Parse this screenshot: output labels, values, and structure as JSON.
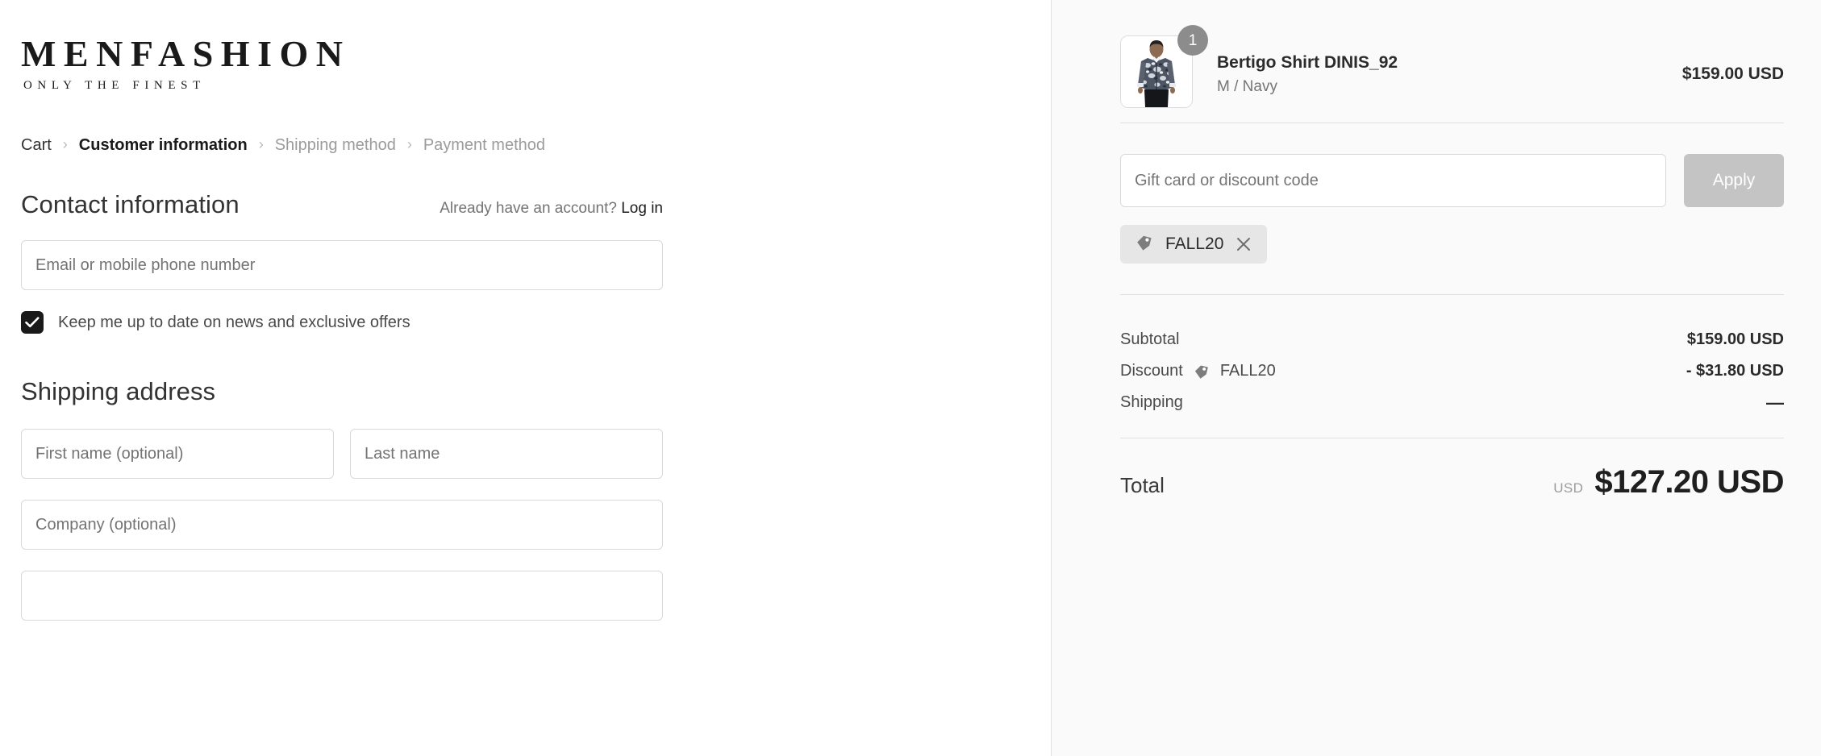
{
  "brand": {
    "name": "MENFASHION",
    "tagline": "ONLY THE FINEST"
  },
  "breadcrumb": {
    "items": [
      {
        "label": "Cart",
        "state": "done"
      },
      {
        "label": "Customer information",
        "state": "active"
      },
      {
        "label": "Shipping method",
        "state": "upcoming"
      },
      {
        "label": "Payment method",
        "state": "upcoming"
      }
    ],
    "separator": "›"
  },
  "contact": {
    "title": "Contact information",
    "account_prompt": "Already have an account?",
    "login_label": "Log in",
    "email_placeholder": "Email or mobile phone number",
    "email_value": "",
    "newsletter_label": "Keep me up to date on news and exclusive offers",
    "newsletter_checked": true
  },
  "shipping_address": {
    "title": "Shipping address",
    "first_name_placeholder": "First name (optional)",
    "first_name_value": "",
    "last_name_placeholder": "Last name",
    "last_name_value": "",
    "company_placeholder": "Company (optional)",
    "company_value": "",
    "address_placeholder": "",
    "address_value": ""
  },
  "order_summary": {
    "line_items": [
      {
        "title": "Bertigo Shirt DINIS_92",
        "variant": "M / Navy",
        "quantity": "1",
        "price": "$159.00 USD"
      }
    ],
    "discount_input_placeholder": "Gift card or discount code",
    "discount_input_value": "",
    "apply_label": "Apply",
    "applied_discounts": [
      {
        "code": "FALL20"
      }
    ],
    "rows": [
      {
        "label": "Subtotal",
        "code": "",
        "value": "$159.00 USD"
      },
      {
        "label": "Discount",
        "code": "FALL20",
        "value": "- $31.80 USD"
      },
      {
        "label": "Shipping",
        "code": "",
        "value": "—"
      }
    ],
    "total": {
      "label": "Total",
      "currency": "USD",
      "amount": "$127.20 USD"
    }
  },
  "colors": {
    "accent": "#1a1a1a",
    "panel_bg": "#fafafa",
    "border": "#d9d9d9",
    "divider": "#e0e0e0",
    "muted_text": "#9b9b9b",
    "apply_button": "#c4c4c4",
    "badge": "#8c8c8c",
    "tag_pill": "#e6e6e6"
  }
}
